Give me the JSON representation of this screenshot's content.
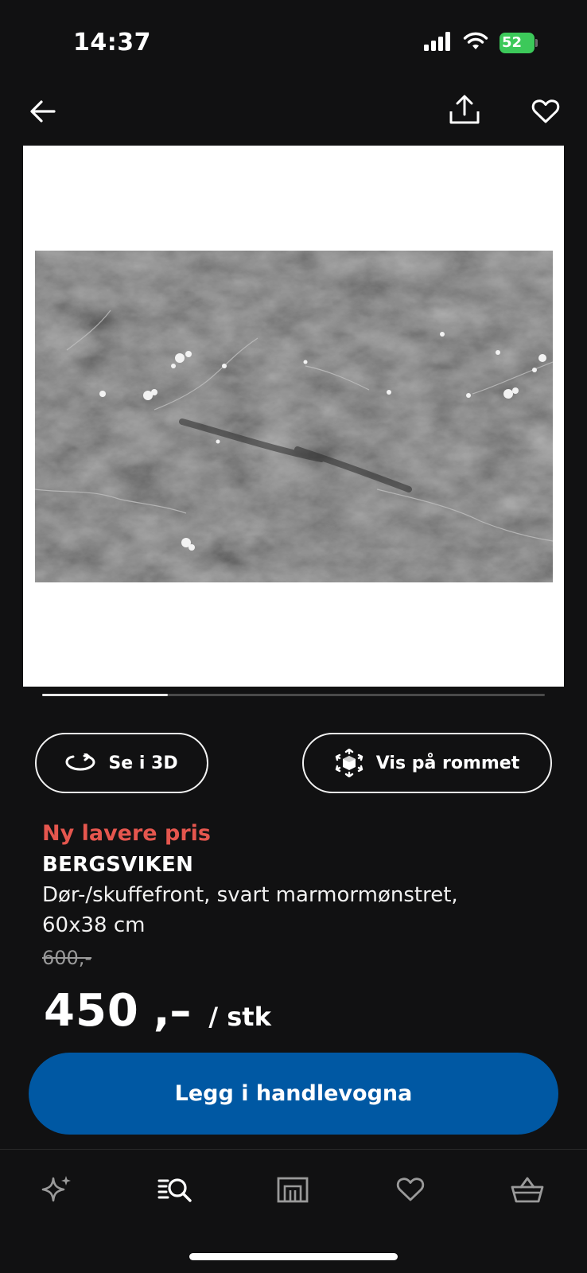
{
  "status_bar": {
    "time": "14:37",
    "battery_percent": "52",
    "icons": [
      "signal-icon",
      "wifi-icon",
      "battery-charging-icon"
    ]
  },
  "top_nav": {
    "icons": [
      "back-arrow-icon",
      "share-icon",
      "heart-icon"
    ]
  },
  "product_image": {
    "gallery_progress": 0.25
  },
  "actions": {
    "view_3d_label": "Se i 3D",
    "view_room_label": "Vis på rommet"
  },
  "product": {
    "promo_label": "Ny lavere pris",
    "name": "BERGSVIKEN",
    "description": "Dør-/skuffefront, svart marmormønstret, 60x38 cm",
    "old_price": "600,-",
    "price_integer": "450",
    "price_suffix": ",–",
    "price_unit": "/ stk"
  },
  "cart": {
    "button_label": "Legg i handlevogna"
  },
  "bottom_nav": {
    "items": [
      "sparkle-icon",
      "search-list-icon",
      "store-icon",
      "heart-icon",
      "basket-icon"
    ]
  },
  "colors": {
    "background": "#111112",
    "promo": "#e5564e",
    "primary_button": "#0058a3",
    "battery": "#3cc95a"
  }
}
